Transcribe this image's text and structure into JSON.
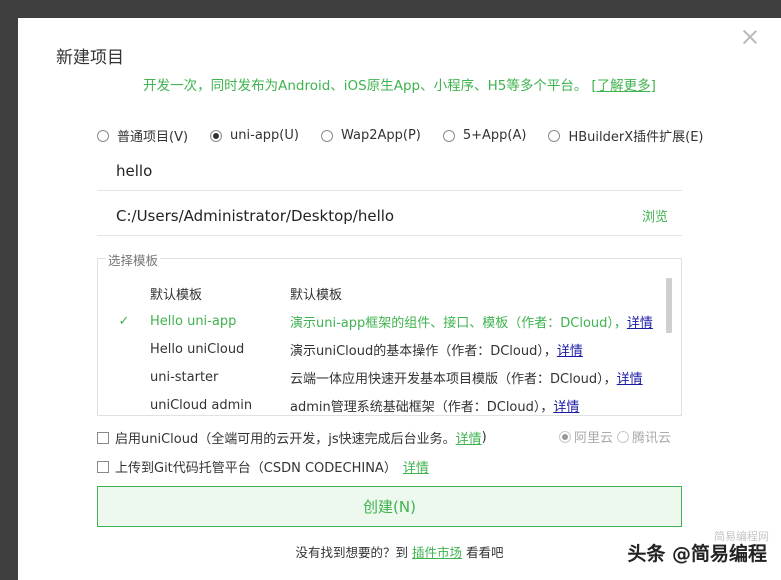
{
  "dialog": {
    "title": "新建项目",
    "subtitle": "开发一次，同时发布为Android、iOS原生App、小程序、H5等多个平台。",
    "subtitle_link": "[了解更多]"
  },
  "project_types": [
    {
      "label": "普通项目(V)",
      "selected": false
    },
    {
      "label": "uni-app(U)",
      "selected": true
    },
    {
      "label": "Wap2App(P)",
      "selected": false
    },
    {
      "label": "5+App(A)",
      "selected": false
    },
    {
      "label": "HBuilderX插件扩展(E)",
      "selected": false
    }
  ],
  "project_name": {
    "value": "hello"
  },
  "project_path": {
    "value": "C:/Users/Administrator/Desktop/hello",
    "browse_label": "浏览"
  },
  "templates": {
    "legend": "选择模板",
    "items": [
      {
        "name": "默认模板",
        "desc": "默认模板",
        "detail": "",
        "selected": false
      },
      {
        "name": "Hello uni-app",
        "desc": "演示uni-app框架的组件、接口、模板（作者：DCloud），",
        "detail": "详情",
        "selected": true
      },
      {
        "name": "Hello uniCloud",
        "desc": "演示uniCloud的基本操作（作者：DCloud），",
        "detail": "详情",
        "selected": false
      },
      {
        "name": "uni-starter",
        "desc": "云端一体应用快速开发基本项目模版（作者：DCloud），",
        "detail": "详情",
        "selected": false
      },
      {
        "name": "uniCloud admin",
        "desc": "admin管理系统基础框架（作者：DCloud），",
        "detail": "详情",
        "selected": false
      }
    ],
    "check_mark": "✓"
  },
  "unicloud_option": {
    "label": "启用uniCloud（全端可用的云开发，js快速完成后台业务。",
    "link": "详情",
    "suffix": ")",
    "providers": [
      {
        "label": "阿里云",
        "selected": true
      },
      {
        "label": "腾讯云",
        "selected": false
      }
    ]
  },
  "git_option": {
    "label": "上传到Git代码托管平台（CSDN CODECHINA）",
    "link": "详情"
  },
  "create_button": "创建(N)",
  "footer": {
    "prefix": "没有找到想要的？到",
    "link": "插件市场",
    "suffix": "看看吧"
  },
  "watermark": {
    "main": "头条 @简易编程",
    "faint": "简易编程网"
  },
  "colors": {
    "accent": "#3fb34f",
    "link_blue": "#1a1aa6",
    "backdrop": "#3f3f3f"
  }
}
